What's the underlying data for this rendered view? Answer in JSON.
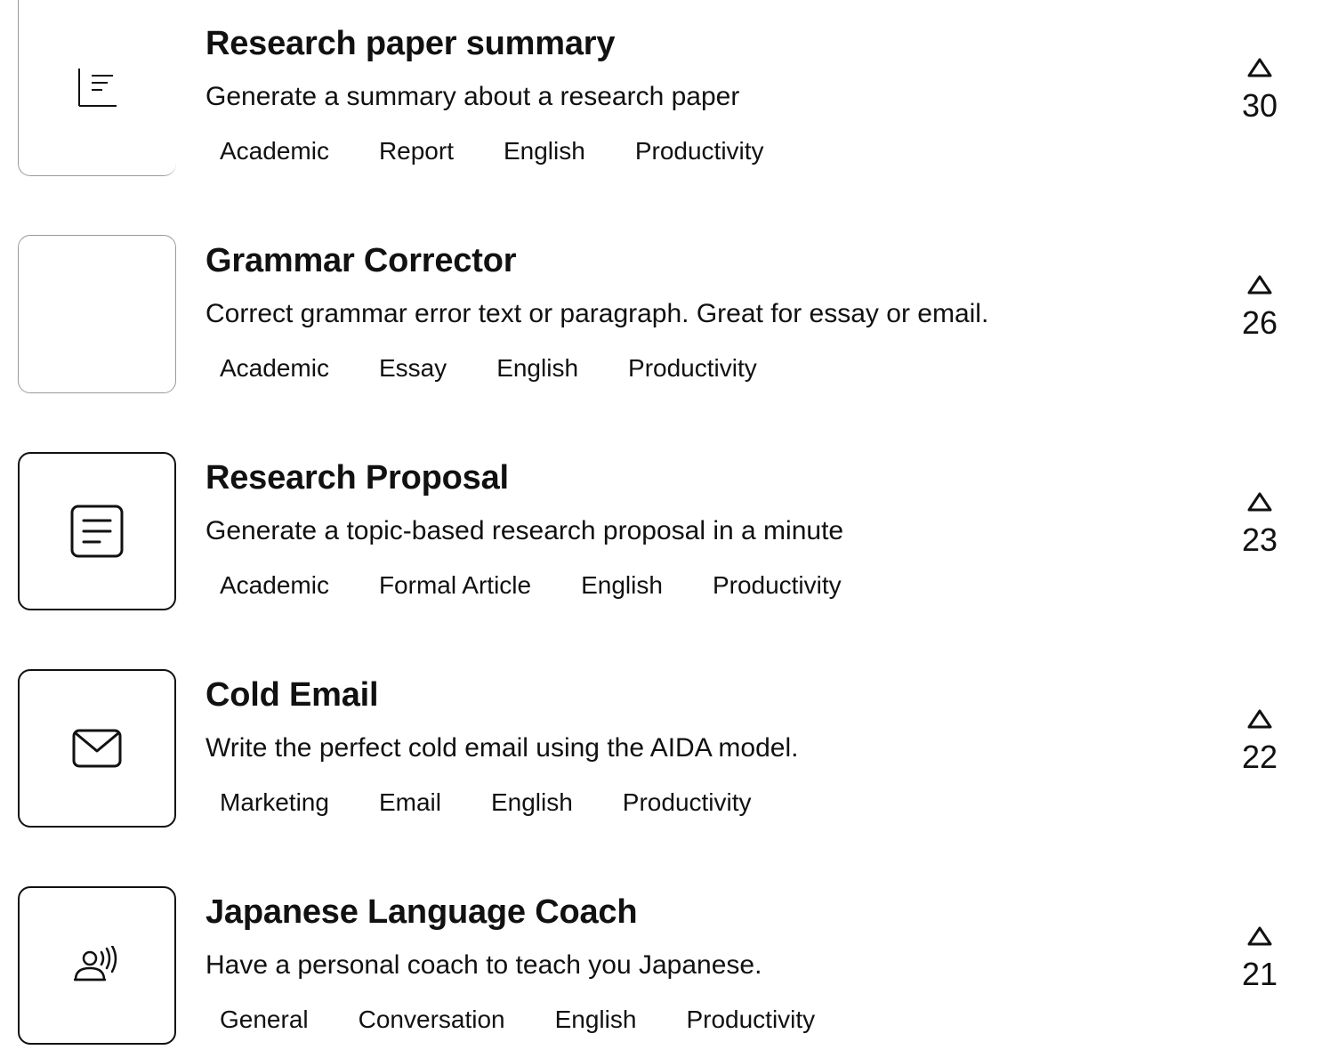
{
  "prompts": [
    {
      "title": "Research paper summary",
      "description": "Generate a summary about a research paper",
      "tags": [
        "Academic",
        "Report",
        "English",
        "Productivity"
      ],
      "votes": "30",
      "icon": "document-lines-icon"
    },
    {
      "title": "Grammar Corrector",
      "description": "Correct grammar error text or paragraph. Great for essay or email.",
      "tags": [
        "Academic",
        "Essay",
        "English",
        "Productivity"
      ],
      "votes": "26",
      "icon": "blank-icon"
    },
    {
      "title": "Research Proposal",
      "description": "Generate a topic-based research proposal in a minute",
      "tags": [
        "Academic",
        "Formal Article",
        "English",
        "Productivity"
      ],
      "votes": "23",
      "icon": "document-icon"
    },
    {
      "title": "Cold Email",
      "description": "Write the perfect cold email using the AIDA model.",
      "tags": [
        "Marketing",
        "Email",
        "English",
        "Productivity"
      ],
      "votes": "22",
      "icon": "envelope-icon"
    },
    {
      "title": "Japanese Language Coach",
      "description": "Have a personal coach to teach you Japanese.",
      "tags": [
        "General",
        "Conversation",
        "English",
        "Productivity"
      ],
      "votes": "21",
      "icon": "speaking-person-icon"
    }
  ]
}
